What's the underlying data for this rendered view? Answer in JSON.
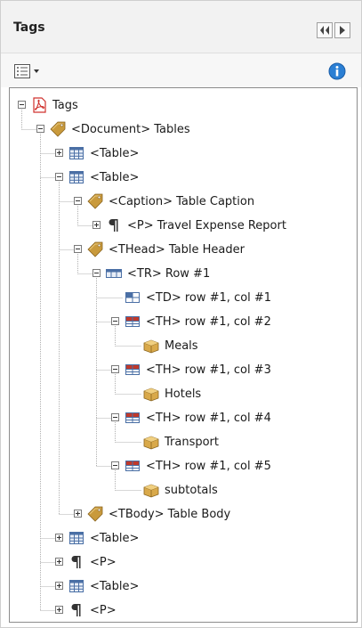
{
  "panel": {
    "title": "Tags",
    "nav_buttons": [
      "back-icon",
      "forward-icon"
    ],
    "options_button": "options-menu-icon",
    "info_button": "info-icon"
  },
  "tree": {
    "root": {
      "label": "Tags",
      "icon": "pdf-tags-icon"
    },
    "nodes": [
      {
        "label": "<Document> Tables",
        "icon": "tag-icon",
        "expanded": true
      },
      {
        "label": "<Table>",
        "icon": "table-icon",
        "expanded": false
      },
      {
        "label": "<Table>",
        "icon": "table-icon",
        "expanded": true
      },
      {
        "label": "<Caption> Table Caption",
        "icon": "tag-icon",
        "expanded": true
      },
      {
        "label": "<P> Travel Expense Report",
        "icon": "paragraph-icon",
        "expanded": false
      },
      {
        "label": "<THead> Table Header",
        "icon": "tag-icon",
        "expanded": true
      },
      {
        "label": "<TR> Row #1",
        "icon": "table-row-icon",
        "expanded": true
      },
      {
        "label": "<TD> row #1, col #1",
        "icon": "table-cell-icon",
        "expanded": null
      },
      {
        "label": "<TH> row #1, col #2",
        "icon": "table-header-cell-icon",
        "expanded": true
      },
      {
        "label": "Meals",
        "icon": "content-box-icon",
        "expanded": null
      },
      {
        "label": "<TH> row #1, col #3",
        "icon": "table-header-cell-icon",
        "expanded": true
      },
      {
        "label": "Hotels",
        "icon": "content-box-icon",
        "expanded": null
      },
      {
        "label": "<TH> row #1, col #4",
        "icon": "table-header-cell-icon",
        "expanded": true
      },
      {
        "label": "Transport",
        "icon": "content-box-icon",
        "expanded": null
      },
      {
        "label": "<TH> row #1, col #5",
        "icon": "table-header-cell-icon",
        "expanded": true
      },
      {
        "label": "subtotals",
        "icon": "content-box-icon",
        "expanded": null
      },
      {
        "label": "<TBody> Table Body",
        "icon": "tag-icon",
        "expanded": false
      },
      {
        "label": "<Table>",
        "icon": "table-icon",
        "expanded": false
      },
      {
        "label": "<P>",
        "icon": "paragraph-icon",
        "expanded": false
      },
      {
        "label": "<Table>",
        "icon": "table-icon",
        "expanded": false
      },
      {
        "label": "<P>",
        "icon": "paragraph-icon",
        "expanded": false
      }
    ]
  },
  "colors": {
    "tag_gold": "#c99a3c",
    "table_blue": "#4a6fa5",
    "header_red": "#c0392b",
    "info_blue": "#2b7fd4",
    "pdf_red": "#d0312d"
  }
}
